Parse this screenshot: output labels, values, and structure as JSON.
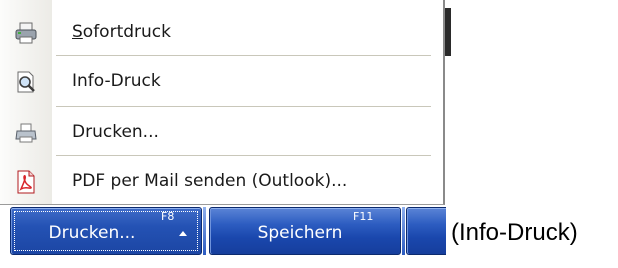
{
  "menu": {
    "items": [
      {
        "label": "Sofortdruck",
        "icon": "printer-fast-icon"
      },
      {
        "label": "Info-Druck",
        "icon": "print-preview-icon"
      },
      {
        "label": "Drucken...",
        "icon": "printer-icon"
      },
      {
        "label": "PDF per Mail senden (Outlook)...",
        "icon": "pdf-icon"
      }
    ]
  },
  "toolbar": {
    "print_label": "Drucken...",
    "print_key": "F8",
    "save_label": "Speichern",
    "save_key": "F11"
  },
  "caption": "(Info-Druck)",
  "colors": {
    "button_blue": "#2452b4",
    "pdf_red": "#d8262b"
  }
}
